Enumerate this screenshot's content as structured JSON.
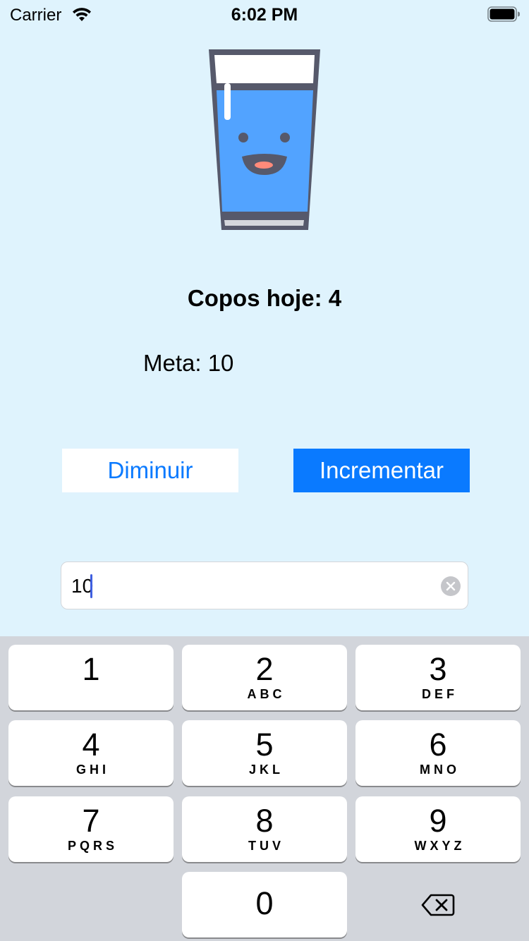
{
  "status_bar": {
    "carrier": "Carrier",
    "time": "6:02 PM",
    "wifi_icon": "wifi-icon",
    "battery_icon": "battery-icon"
  },
  "illustration": {
    "icon": "smiling-water-glass-icon",
    "water_color": "#52a3ff"
  },
  "counter": {
    "cups_today": "Copos hoje: 4",
    "goal": "Meta: 10"
  },
  "buttons": {
    "decrease": "Diminuir",
    "increase": "Incrementar"
  },
  "goal_input": {
    "value": "10",
    "clear_icon": "clear-icon"
  },
  "keyboard": {
    "keys": [
      {
        "digit": "1",
        "letters": ""
      },
      {
        "digit": "2",
        "letters": "ABC"
      },
      {
        "digit": "3",
        "letters": "DEF"
      },
      {
        "digit": "4",
        "letters": "GHI"
      },
      {
        "digit": "5",
        "letters": "JKL"
      },
      {
        "digit": "6",
        "letters": "MNO"
      },
      {
        "digit": "7",
        "letters": "PQRS"
      },
      {
        "digit": "8",
        "letters": "TUV"
      },
      {
        "digit": "9",
        "letters": "WXYZ"
      },
      {
        "digit": "0",
        "letters": ""
      }
    ],
    "delete_icon": "backspace-icon"
  },
  "colors": {
    "background": "#dff3fd",
    "accent": "#0a7aff",
    "keyboard_bg": "#d2d5db"
  }
}
